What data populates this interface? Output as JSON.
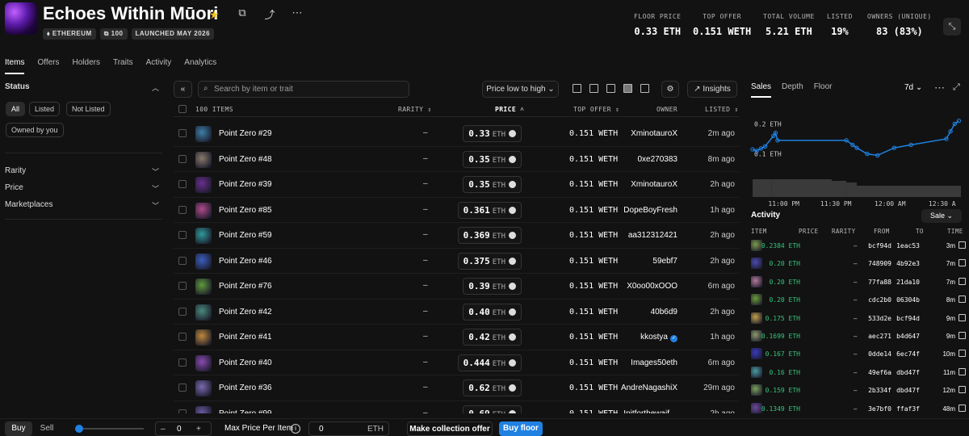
{
  "header": {
    "title": "Echoes Within Mūori",
    "tags": [
      "⬧ ETHEREUM",
      "⧉ 100",
      "LAUNCHED MAY 2026"
    ],
    "stats": [
      {
        "label": "FLOOR PRICE",
        "value": "0.33 ETH"
      },
      {
        "label": "TOP OFFER",
        "value": "0.151 WETH"
      },
      {
        "label": "TOTAL VOLUME",
        "value": "5.21 ETH"
      },
      {
        "label": "LISTED",
        "value": "19%"
      },
      {
        "label": "OWNERS (UNIQUE)",
        "value": "83 (83%)"
      }
    ]
  },
  "tabs": [
    "Items",
    "Offers",
    "Holders",
    "Traits",
    "Activity",
    "Analytics"
  ],
  "sidebar": {
    "status_title": "Status",
    "chips": [
      "All",
      "Listed",
      "Not Listed",
      "Owned by you"
    ],
    "sections": [
      "Rarity",
      "Price",
      "Marketplaces"
    ]
  },
  "toolbar": {
    "search_placeholder": "Search by item or trait",
    "sort_label": "Price low to high",
    "insights_label": "Insights"
  },
  "table": {
    "headers": {
      "items": "100 ITEMS",
      "rarity": "RARITY",
      "price": "PRICE",
      "top_offer": "TOP OFFER",
      "owner": "OWNER",
      "listed": "LISTED"
    },
    "rows": [
      {
        "name": "Point Zero #29",
        "rarity": "–",
        "price": "0.33",
        "unit": "ETH",
        "offer": "0.151 WETH",
        "owner": "XminotauroX",
        "listed": "2m ago",
        "color": "#3d7ea6"
      },
      {
        "name": "Point Zero #48",
        "rarity": "–",
        "price": "0.35",
        "unit": "ETH",
        "offer": "0.151 WETH",
        "owner": "0xe270383",
        "listed": "8m ago",
        "color": "#8a7a6a"
      },
      {
        "name": "Point Zero #39",
        "rarity": "–",
        "price": "0.35",
        "unit": "ETH",
        "offer": "0.151 WETH",
        "owner": "XminotauroX",
        "listed": "2h ago",
        "color": "#6a2f8f"
      },
      {
        "name": "Point Zero #85",
        "rarity": "–",
        "price": "0.361",
        "unit": "ETH",
        "offer": "0.151 WETH",
        "owner": "DopeBoyFresh",
        "listed": "1h ago",
        "color": "#b04a8a"
      },
      {
        "name": "Point Zero #59",
        "rarity": "–",
        "price": "0.369",
        "unit": "ETH",
        "offer": "0.151 WETH",
        "owner": "aa312312421",
        "listed": "2h ago",
        "color": "#2f9a9a"
      },
      {
        "name": "Point Zero #46",
        "rarity": "–",
        "price": "0.375",
        "unit": "ETH",
        "offer": "0.151 WETH",
        "owner": "59ebf7",
        "listed": "2h ago",
        "color": "#3a5fbf"
      },
      {
        "name": "Point Zero #76",
        "rarity": "–",
        "price": "0.39",
        "unit": "ETH",
        "offer": "0.151 WETH",
        "owner": "X0oo00xOOO",
        "listed": "6m ago",
        "color": "#5f9a3a"
      },
      {
        "name": "Point Zero #42",
        "rarity": "–",
        "price": "0.40",
        "unit": "ETH",
        "offer": "0.151 WETH",
        "owner": "40b6d9",
        "listed": "2h ago",
        "color": "#4a8a7a"
      },
      {
        "name": "Point Zero #41",
        "rarity": "–",
        "price": "0.42",
        "unit": "ETH",
        "offer": "0.151 WETH",
        "owner": "kkostya",
        "listed": "1h ago",
        "color": "#c08a3a",
        "verified": true
      },
      {
        "name": "Point Zero #40",
        "rarity": "–",
        "price": "0.444",
        "unit": "ETH",
        "offer": "0.151 WETH",
        "owner": "Images50eth",
        "listed": "6m ago",
        "color": "#8a4ab0"
      },
      {
        "name": "Point Zero #36",
        "rarity": "–",
        "price": "0.62",
        "unit": "ETH",
        "offer": "0.151 WETH",
        "owner": "AndreNagashiX",
        "listed": "29m ago",
        "color": "#7a6ab0"
      },
      {
        "name": "Point Zero #99",
        "rarity": "–",
        "price": "0.69",
        "unit": "ETH",
        "offer": "0.151 WETH",
        "owner": "Initforthewaif…",
        "listed": "2h ago",
        "color": "#6a5aa0"
      }
    ]
  },
  "right_panel": {
    "tabs": [
      "Sales",
      "Depth",
      "Floor"
    ],
    "range": "7d",
    "activity_title": "Activity",
    "activity_filter": "Sale",
    "activity_headers": {
      "item": "ITEM",
      "price": "PRICE",
      "rarity": "RARITY",
      "from": "FROM",
      "to": "TO",
      "time": "TIME"
    },
    "activity": [
      {
        "price": "0.2384 ETH",
        "rarity": "–",
        "from": "bcf94d",
        "to": "1eac53",
        "time": "3m",
        "color": "#7a9a4a"
      },
      {
        "price": "0.20 ETH",
        "rarity": "–",
        "from": "748909",
        "to": "4b92e3",
        "time": "7m",
        "color": "#4a4ab0"
      },
      {
        "price": "0.20 ETH",
        "rarity": "–",
        "from": "77fa88",
        "to": "21da10",
        "time": "7m",
        "color": "#b07a9a"
      },
      {
        "price": "0.20 ETH",
        "rarity": "–",
        "from": "cdc2b0",
        "to": "06304b",
        "time": "8m",
        "color": "#6a9a3a"
      },
      {
        "price": "0.175 ETH",
        "rarity": "–",
        "from": "533d2e",
        "to": "bcf94d",
        "time": "9m",
        "color": "#c0a04a"
      },
      {
        "price": "0.1699 ETH",
        "rarity": "–",
        "from": "aec271",
        "to": "b4d647",
        "time": "9m",
        "color": "#8a9a6a"
      },
      {
        "price": "0.167 ETH",
        "rarity": "–",
        "from": "0dde14",
        "to": "6ec74f",
        "time": "10m",
        "color": "#3a3ac0"
      },
      {
        "price": "0.16 ETH",
        "rarity": "–",
        "from": "49ef6a",
        "to": "dbd47f",
        "time": "11m",
        "color": "#4a9aa0"
      },
      {
        "price": "0.159 ETH",
        "rarity": "–",
        "from": "2b334f",
        "to": "dbd47f",
        "time": "12m",
        "color": "#7aa05a"
      },
      {
        "price": "0.1349 ETH",
        "rarity": "–",
        "from": "3e7bf0",
        "to": "ffaf3f",
        "time": "48m",
        "color": "#6a4a9a"
      }
    ]
  },
  "chart_data": {
    "type": "scatter",
    "title": "",
    "xlabel": "",
    "ylabel": "",
    "y_ticks": [
      "0.2 ETH",
      "0.1 ETH"
    ],
    "x_ticks": [
      "11:00 PM",
      "11:30 PM",
      "12:00 AM",
      "12:30 A"
    ],
    "series": [
      {
        "values": [
          [
            0.0,
            0.115
          ],
          [
            0.02,
            0.11
          ],
          [
            0.04,
            0.118
          ],
          [
            0.06,
            0.125
          ],
          [
            0.1,
            0.16
          ],
          [
            0.11,
            0.17
          ],
          [
            0.12,
            0.145
          ],
          [
            0.45,
            0.145
          ],
          [
            0.48,
            0.13
          ],
          [
            0.5,
            0.12
          ],
          [
            0.55,
            0.1
          ],
          [
            0.6,
            0.095
          ],
          [
            0.68,
            0.12
          ],
          [
            0.76,
            0.13
          ],
          [
            0.93,
            0.15
          ],
          [
            0.95,
            0.175
          ],
          [
            0.97,
            0.2
          ],
          [
            0.99,
            0.21
          ]
        ]
      }
    ]
  },
  "bottom_bar": {
    "buy": "Buy",
    "sell": "Sell",
    "minus": "–",
    "quantity": "0",
    "plus": "+",
    "max_price_label": "Max Price Per Item",
    "max_price_value": "0",
    "max_price_unit": "ETH",
    "collection_offer": "Make collection offer",
    "buy_floor": "Buy floor"
  },
  "colors": {
    "accent": "#2081e2",
    "positive": "#34c77b",
    "star": "#f2c21b"
  }
}
